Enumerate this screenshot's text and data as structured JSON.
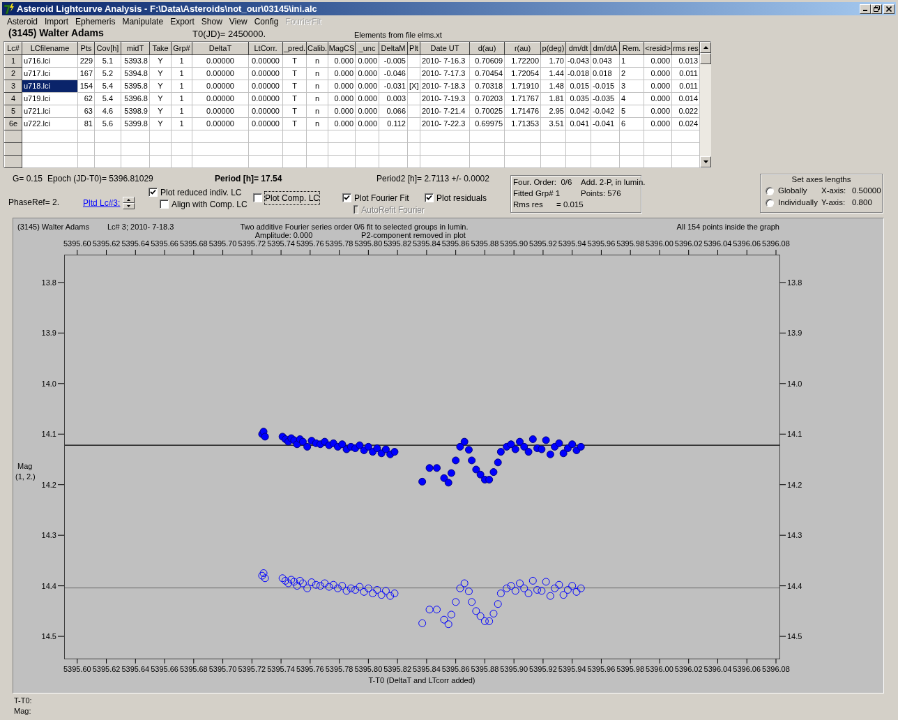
{
  "window": {
    "title": "Asteroid Lightcurve Analysis - F:\\Data\\Asteroids\\not_our\\03145\\ini.alc"
  },
  "menu": [
    {
      "label": "Asteroid",
      "disabled": false
    },
    {
      "label": "Import",
      "disabled": false
    },
    {
      "label": "Ephemeris",
      "disabled": false
    },
    {
      "label": "Manipulate",
      "disabled": false
    },
    {
      "label": "Export",
      "disabled": false
    },
    {
      "label": "Show",
      "disabled": false
    },
    {
      "label": "View",
      "disabled": false
    },
    {
      "label": "Config",
      "disabled": false
    },
    {
      "label": "FourierFit",
      "disabled": true
    }
  ],
  "info": {
    "asteroid": "(3145) Walter Adams",
    "t0": "T0(JD)= 2450000.",
    "elements": "Elements from file elms.xt"
  },
  "table": {
    "columns": [
      "Lc#",
      "LCfilename",
      "Pts",
      "Cov[h]",
      "midT",
      "Take",
      "Grp#",
      "DeltaT",
      "LtCorr.",
      "_pred.",
      "Calib.",
      "MagCS",
      "_unc",
      "DeltaM",
      "Plt",
      "Date UT",
      "d(au)",
      "r(au)",
      "p(deg)",
      "dm/dt",
      "dm/dtA",
      "Rem.",
      "<resid>",
      "rms res"
    ],
    "rows": [
      {
        "selected": false,
        "cells": [
          "1",
          "u716.lci",
          "229",
          "5.1",
          "5393.8",
          "Y",
          "1",
          "0.00000",
          "0.00000",
          "T",
          "n",
          "0.000",
          "0.000",
          "-0.005",
          "",
          "2010- 7-16.3",
          "0.70609",
          "1.72200",
          "1.70",
          "-0.043",
          "0.043",
          "1",
          "0.000",
          "0.013"
        ]
      },
      {
        "selected": false,
        "cells": [
          "2",
          "u717.lci",
          "167",
          "5.2",
          "5394.8",
          "Y",
          "1",
          "0.00000",
          "0.00000",
          "T",
          "n",
          "0.000",
          "0.000",
          "-0.046",
          "",
          "2010- 7-17.3",
          "0.70454",
          "1.72054",
          "1.44",
          "-0.018",
          "0.018",
          "2",
          "0.000",
          "0.011"
        ]
      },
      {
        "selected": true,
        "cells": [
          "3",
          "u718.lci",
          "154",
          "5.4",
          "5395.8",
          "Y",
          "1",
          "0.00000",
          "0.00000",
          "T",
          "n",
          "0.000",
          "0.000",
          "-0.031",
          "[X]",
          "2010- 7-18.3",
          "0.70318",
          "1.71910",
          "1.48",
          "0.015",
          "-0.015",
          "3",
          "0.000",
          "0.011"
        ]
      },
      {
        "selected": false,
        "cells": [
          "4",
          "u719.lci",
          "62",
          "5.4",
          "5396.8",
          "Y",
          "1",
          "0.00000",
          "0.00000",
          "T",
          "n",
          "0.000",
          "0.000",
          "0.003",
          "",
          "2010- 7-19.3",
          "0.70203",
          "1.71767",
          "1.81",
          "0.035",
          "-0.035",
          "4",
          "0.000",
          "0.014"
        ]
      },
      {
        "selected": false,
        "cells": [
          "5",
          "u721.lci",
          "63",
          "4.6",
          "5398.9",
          "Y",
          "1",
          "0.00000",
          "0.00000",
          "T",
          "n",
          "0.000",
          "0.000",
          "0.066",
          "",
          "2010- 7-21.4",
          "0.70025",
          "1.71476",
          "2.95",
          "0.042",
          "-0.042",
          "5",
          "0.000",
          "0.022"
        ]
      },
      {
        "selected": false,
        "cells": [
          "6e",
          "u722.lci",
          "81",
          "5.6",
          "5399.8",
          "Y",
          "1",
          "0.00000",
          "0.00000",
          "T",
          "n",
          "0.000",
          "0.000",
          "0.112",
          "",
          "2010- 7-22.3",
          "0.69975",
          "1.71353",
          "3.51",
          "0.041",
          "-0.041",
          "6",
          "0.000",
          "0.024"
        ]
      }
    ]
  },
  "fit": {
    "g": "G= 0.15",
    "epoch": "Epoch (JD-T0)= 5396.81029",
    "period": "Period [h]= 17.54",
    "period2": "Period2 [h]= 2.7113 +/- 0.0002",
    "phase_ref": "PhaseRef= 2.",
    "plotted_lc_link": "Pltd Lc#3:"
  },
  "checkboxes": [
    {
      "label": "Plot reduced indiv. LC",
      "checked": true,
      "disabled": false,
      "focused": false
    },
    {
      "label": "Align with Comp. LC",
      "checked": false,
      "disabled": false,
      "focused": false
    },
    {
      "label": "Plot Comp. LC",
      "checked": false,
      "disabled": false,
      "focused": true
    },
    {
      "label": "Plot Fourier Fit",
      "checked": true,
      "disabled": false,
      "focused": false
    },
    {
      "label": "AutoRefit Fourier",
      "checked": false,
      "disabled": true,
      "focused": false
    },
    {
      "label": "Plot residuals",
      "checked": true,
      "disabled": false,
      "focused": false
    }
  ],
  "fourier_box": [
    "Four. Order:  0/6",
    "Add. 2-P, in lumin.",
    "Fitted Grp# 1",
    "Points: 576",
    "Rms res      = 0.015"
  ],
  "axes_box": {
    "title": "Set axes lengths",
    "options": [
      {
        "label": "Globally",
        "selected": false,
        "axis": "X-axis:",
        "value": "0.50000"
      },
      {
        "label": "Individually",
        "selected": false,
        "axis": "Y-axis:",
        "value": "0.800"
      }
    ]
  },
  "plot": {
    "object": "(3145) Walter Adams",
    "lc": "Lc# 3; 2010- 7-18.3",
    "description": "Two additive Fourier series order 0/6 fit to selected groups in lumin.",
    "amplitude": "Amplitude: 0.000",
    "p2_note": "P2-component removed in plot",
    "points_note": "All 154 points inside the graph",
    "ylabel_note": "(1, 2.)",
    "chart_data": {
      "type": "scatter",
      "xlabel": "T-T0 (DeltaT and LTcorr added)",
      "ylabel": "Mag",
      "xlim": [
        5395.591,
        5396.0824
      ],
      "ylim": [
        14.544,
        13.745
      ],
      "xticks": [
        {
          "value": 5395.6,
          "label": "5395.60"
        },
        {
          "value": 5395.62,
          "label": "5395.62"
        },
        {
          "value": 5395.64,
          "label": "5395.64"
        },
        {
          "value": 5395.66,
          "label": "5395.66"
        },
        {
          "value": 5395.68,
          "label": "5395.68"
        },
        {
          "value": 5395.7,
          "label": "5395.70"
        },
        {
          "value": 5395.72,
          "label": "5395.72"
        },
        {
          "value": 5395.74,
          "label": "5395.74"
        },
        {
          "value": 5395.76,
          "label": "5395.76"
        },
        {
          "value": 5395.78,
          "label": "5395.78"
        },
        {
          "value": 5395.8,
          "label": "5395.80"
        },
        {
          "value": 5395.82,
          "label": "5395.82"
        },
        {
          "value": 5395.84,
          "label": "5395.84"
        },
        {
          "value": 5395.86,
          "label": "5395.86"
        },
        {
          "value": 5395.88,
          "label": "5395.88"
        },
        {
          "value": 5395.9,
          "label": "5395.90"
        },
        {
          "value": 5395.92,
          "label": "5395.92"
        },
        {
          "value": 5395.94,
          "label": "5395.94"
        },
        {
          "value": 5395.96,
          "label": "5395.96"
        },
        {
          "value": 5395.98,
          "label": "5395.98"
        },
        {
          "value": 5396.0,
          "label": "5396.00"
        },
        {
          "value": 5396.02,
          "label": "5396.02"
        },
        {
          "value": 5396.04,
          "label": "5396.04"
        },
        {
          "value": 5396.06,
          "label": "5396.06"
        },
        {
          "value": 5396.08,
          "label": "5396.08"
        }
      ],
      "yticks": [
        {
          "value": 13.8,
          "label": "13.8"
        },
        {
          "value": 13.9,
          "label": "13.9"
        },
        {
          "value": 14.0,
          "label": "14.0"
        },
        {
          "value": 14.1,
          "label": "14.1"
        },
        {
          "value": 14.2,
          "label": "14.2"
        },
        {
          "value": 14.3,
          "label": "14.3"
        },
        {
          "value": 14.4,
          "label": "14.4"
        },
        {
          "value": 14.5,
          "label": "14.5"
        }
      ],
      "x": [
        5395.727,
        5395.728,
        5395.729,
        5395.741,
        5395.743,
        5395.745,
        5395.747,
        5395.749,
        5395.751,
        5395.753,
        5395.755,
        5395.758,
        5395.761,
        5395.764,
        5395.767,
        5395.77,
        5395.773,
        5395.776,
        5395.779,
        5395.782,
        5395.785,
        5395.788,
        5395.791,
        5395.794,
        5395.797,
        5395.8,
        5395.803,
        5395.806,
        5395.809,
        5395.812,
        5395.815,
        5395.818,
        5395.837,
        5395.842,
        5395.847,
        5395.852,
        5395.855,
        5395.857,
        5395.86,
        5395.863,
        5395.866,
        5395.869,
        5395.871,
        5395.874,
        5395.877,
        5395.88,
        5395.883,
        5395.886,
        5395.889,
        5395.891,
        5395.895,
        5395.898,
        5395.901,
        5395.904,
        5395.907,
        5395.91,
        5395.913,
        5395.916,
        5395.919,
        5395.922,
        5395.925,
        5395.928,
        5395.931,
        5395.934,
        5395.937,
        5395.94,
        5395.943,
        5395.946
      ],
      "series": [
        {
          "marker": "circle",
          "color": "#0000ff",
          "values": [
            14.1,
            14.095,
            14.105,
            14.105,
            14.11,
            14.115,
            14.108,
            14.112,
            14.12,
            14.11,
            14.115,
            14.125,
            14.113,
            14.118,
            14.12,
            14.115,
            14.122,
            14.118,
            14.125,
            14.12,
            14.13,
            14.125,
            14.128,
            14.122,
            14.132,
            14.125,
            14.135,
            14.128,
            14.138,
            14.13,
            14.14,
            14.135,
            14.194,
            14.167,
            14.167,
            14.187,
            14.196,
            14.177,
            14.152,
            14.125,
            14.115,
            14.131,
            14.152,
            14.17,
            14.18,
            14.19,
            14.19,
            14.175,
            14.156,
            14.135,
            14.125,
            14.12,
            14.13,
            14.115,
            14.125,
            14.135,
            14.11,
            14.128,
            14.13,
            14.112,
            14.14,
            14.125,
            14.118,
            14.138,
            14.128,
            14.12,
            14.132,
            14.125
          ]
        },
        {
          "marker": "circle",
          "color": "#0000ff",
          "values": [
            14.38,
            14.375,
            14.385,
            14.385,
            14.39,
            14.395,
            14.388,
            14.392,
            14.4,
            14.39,
            14.395,
            14.405,
            14.393,
            14.398,
            14.4,
            14.395,
            14.402,
            14.398,
            14.405,
            14.4,
            14.41,
            14.405,
            14.408,
            14.402,
            14.412,
            14.405,
            14.415,
            14.408,
            14.418,
            14.41,
            14.42,
            14.415,
            14.474,
            14.447,
            14.447,
            14.467,
            14.476,
            14.457,
            14.432,
            14.405,
            14.395,
            14.411,
            14.432,
            14.45,
            14.46,
            14.47,
            14.47,
            14.455,
            14.436,
            14.415,
            14.405,
            14.4,
            14.41,
            14.395,
            14.405,
            14.415,
            14.39,
            14.408,
            14.41,
            14.392,
            14.42,
            14.405,
            14.398,
            14.418,
            14.408,
            14.4,
            14.412,
            14.405
          ]
        }
      ],
      "ref_lines": [
        {
          "axis": "y",
          "value": 14.122,
          "color": "#000000"
        },
        {
          "axis": "y",
          "value": 14.404,
          "color": "#808080"
        }
      ]
    },
    "right_axis_labels": [
      "13.8",
      "13.9",
      "14.0",
      "14.1",
      "14.2",
      "14.3",
      "14.4",
      "14.5"
    ]
  },
  "status": {
    "time": "T-T0:",
    "mag": "Mag:"
  }
}
